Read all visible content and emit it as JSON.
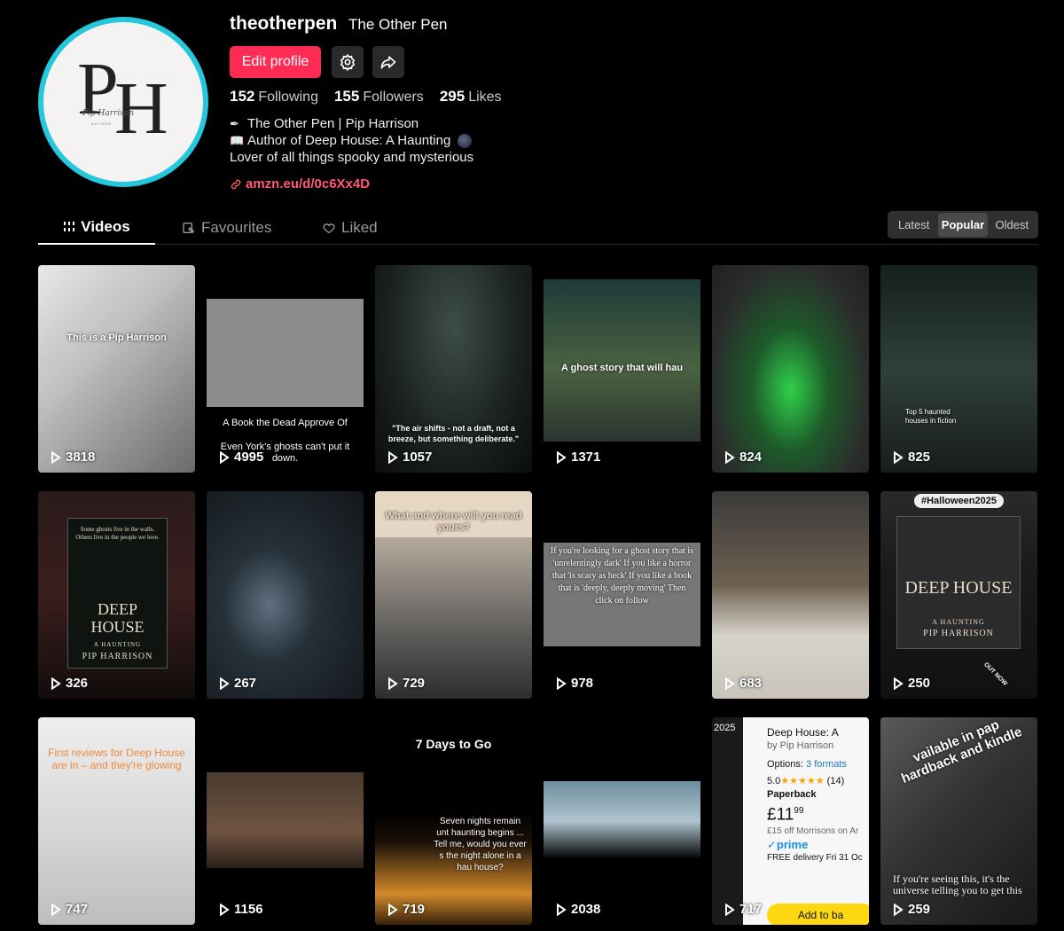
{
  "profile": {
    "username": "theotherpen",
    "nickname": "The Other Pen",
    "avatar_letters": "PH",
    "avatar_sig": "Pip Harrison",
    "avatar_sub": "AUTHOR",
    "edit_label": "Edit profile",
    "stats": {
      "following_count": "152",
      "following_label": "Following",
      "followers_count": "155",
      "followers_label": "Followers",
      "likes_count": "295",
      "likes_label": "Likes"
    },
    "bio": {
      "line1": "The Other Pen | Pip Harrison",
      "line2": "Author of Deep House: A Haunting",
      "line3": "Lover of all things spooky and mysterious"
    },
    "link": "amzn.eu/d/0c6Xx4D"
  },
  "tabs": {
    "videos": "Videos",
    "favourites": "Favourites",
    "liked": "Liked"
  },
  "sort": {
    "latest": "Latest",
    "popular": "Popular",
    "oldest": "Oldest"
  },
  "videos": [
    {
      "views": "3818",
      "caption": "This is a Pip Harrison"
    },
    {
      "views": "4995",
      "caption": "A Book the Dead Approve Of",
      "caption2": "Even York's ghosts can't put it down."
    },
    {
      "views": "1057",
      "caption": "\"The air shifts - not a draft, not a breeze, but something deliberate.\""
    },
    {
      "views": "1371",
      "caption": "A ghost story that will hau"
    },
    {
      "views": "824",
      "caption": ""
    },
    {
      "views": "825",
      "caption": "Top 5 haunted houses in fiction"
    },
    {
      "views": "326",
      "caption": "Some ghosts live in the walls. Others live in the people we love.",
      "book_title": "DEEP HOUSE",
      "book_sub": "A HAUNTING",
      "book_author": "PIP HARRISON"
    },
    {
      "views": "267",
      "caption": ""
    },
    {
      "views": "729",
      "caption": "What and where will you read yours?"
    },
    {
      "views": "978",
      "caption": "If you're looking for a ghost story that is 'unrelentingly dark' If you like a horror that 'is scary as heck' If you like a book that is 'deeply, deeply moving' Then click on follow"
    },
    {
      "views": "683",
      "caption": ""
    },
    {
      "views": "250",
      "caption": "#Halloween2025",
      "book_title": "DEEP HOUSE",
      "book_sub": "A HAUNTING",
      "book_author": "PIP HARRISON",
      "badge": "OUT NOW"
    },
    {
      "views": "747",
      "caption": "First reviews for Deep House are in – and they're glowing"
    },
    {
      "views": "1156",
      "caption": ""
    },
    {
      "views": "719",
      "caption": "7 Days to Go",
      "caption2": "Seven nights remain unt haunting begins ... Tell me, would you ever s the night alone in a hau house?"
    },
    {
      "views": "2038",
      "caption": ""
    },
    {
      "views": "717",
      "amazon": {
        "year": "2025",
        "title": "Deep House: A",
        "by": "by Pip Harrison",
        "options": "Options:",
        "formats": "3 formats",
        "rating": "5.0",
        "stars": "★★★★★",
        "count": "(14)",
        "format": "Paperback",
        "price_main": "£11",
        "price_sup": "99",
        "offer": "£15 off Morrisons on Ar",
        "prime": "✓prime",
        "delivery": "FREE delivery Fri 31 Oc",
        "cart": "Add to ba"
      }
    },
    {
      "views": "259",
      "caption": "vailable in pap hardback and kindle",
      "caption2": "If you're seeing this, it's the universe telling you to get this"
    }
  ]
}
